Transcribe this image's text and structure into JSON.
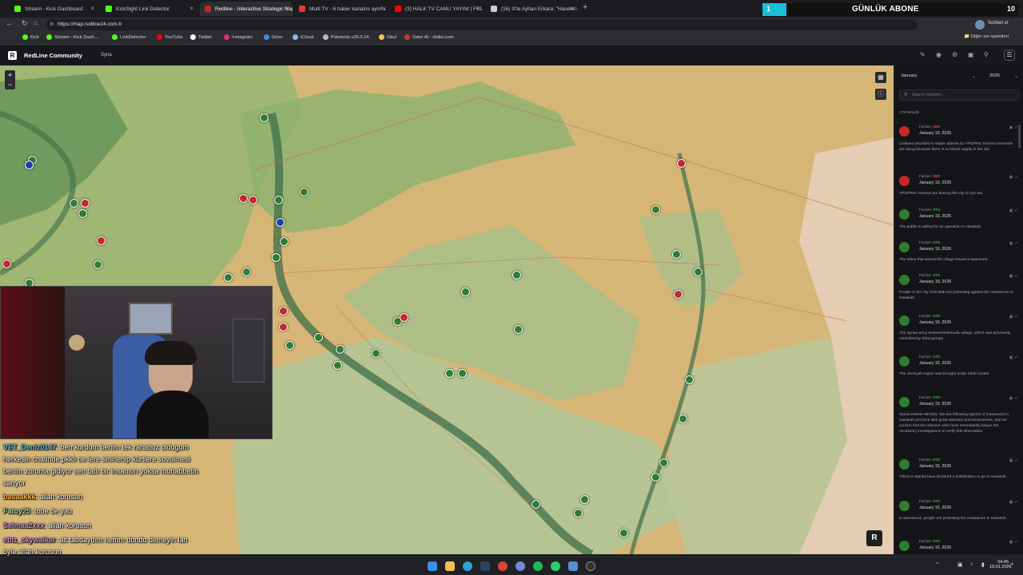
{
  "browser": {
    "tabs": [
      {
        "label": "Stream - Kick Dashboard",
        "active": false,
        "color": "#53fc18"
      },
      {
        "label": "KickSight Link Detector",
        "active": false,
        "color": "#53fc18"
      },
      {
        "label": "Redline - Interactive Strategic Map",
        "active": true,
        "color": "#c62828"
      },
      {
        "label": "Multi TV - 6 haber kanalını aynı a",
        "active": false,
        "color": "#e53935"
      },
      {
        "label": "(3) HALK TV CANLI YAYINI | FULL H",
        "active": false,
        "color": "#ff0000"
      },
      {
        "label": "(16) X'te Ayhan Erkara: \"Haseke'd",
        "active": false,
        "color": "#cccccc"
      }
    ],
    "url": "https://map.redline24.com.tr",
    "bookmarks": [
      "Kick",
      "Stream - Kick Dash...",
      "LinkDetector",
      "YouTube",
      "Twitter",
      "Instagram",
      "Drive",
      "iCloud",
      "Paletools v26.0.24",
      "Okul",
      "Satın Al - obilet.com"
    ],
    "other_bookmarks": "Diğer yer işaretleri",
    "sohbet": "Sohbet et"
  },
  "overlay": {
    "sub_goal_label": "GÜNLÜK ABONE",
    "sub_goal_current": "1",
    "sub_goal_target": "10"
  },
  "app": {
    "brand": "RedLine Community",
    "breadcrumb": "Syria",
    "month_select": "January",
    "year_select": "2026",
    "search_placeholder": "Search Markers...",
    "results_count": "178 Results",
    "faction_label": "Faction:"
  },
  "feed": [
    {
      "faction": "SDF",
      "date": "January 19, 2026",
      "text": "Civilians wounded in sniper attacks by YPG/PKK terrorist remnants are dying because there is no blood supply in the city.",
      "color": "#c62828"
    },
    {
      "faction": "SDF",
      "date": "January 19, 2026",
      "text": "YPG/PKK convoys are leaving the city of Ayn-Isa.",
      "color": "#c62828"
    },
    {
      "faction": "STG",
      "date": "January 19, 2026",
      "text": "The public is calling for an operation in Hasakah.",
      "color": "#2e7d32"
    },
    {
      "faction": "STG",
      "date": "January 19, 2026",
      "text": "The tribes that seized the village issued a statement.",
      "color": "#2e7d32"
    },
    {
      "faction": "STG",
      "date": "January 19, 2026",
      "text": "People in the city of El-Bab are protesting against the massacres in Hasakah.",
      "color": "#2e7d32"
    },
    {
      "faction": "STG",
      "date": "January 19, 2026",
      "text": "The Syrian army entered Mahmudlu village, which was previously controlled by tribal groups.",
      "color": "#2e7d32"
    },
    {
      "faction": "STG",
      "date": "January 19, 2026",
      "text": "The Jarmiyah region was brought under tribal control.",
      "color": "#2e7d32"
    },
    {
      "faction": "STG",
      "date": "January 19, 2026",
      "text": "Syrian Interior Ministry: We are following reports of massacres in Hasakah province with great attention and seriousness, and we confirm that the relevant units have immediately begun the necessary investigations to verify this information.",
      "color": "#2e7d32"
    },
    {
      "faction": "STG",
      "date": "January 19, 2026",
      "text": "Tribes in Manbij have declared a mobilization to go to Hasakah.",
      "color": "#2e7d32"
    },
    {
      "faction": "STG",
      "date": "January 19, 2026",
      "text": "In Damascus, people are protesting the massacres in Hasakah.",
      "color": "#2e7d32"
    },
    {
      "faction": "STG",
      "date": "January 19, 2026",
      "text": "",
      "color": "#2e7d32"
    }
  ],
  "chat": [
    {
      "user": "VET_Deniz0147",
      "msg": ": ben kurdum benim tek rahatsız oldugum",
      "color": "#4fc3f7"
    },
    {
      "user": "",
      "msg": "herkesin chatinde pkkli oe lere sinirlenip kürtlere sovulmesi",
      "color": "#ffffff"
    },
    {
      "user": "",
      "msg": "benim zoruma gidiyor sen tatlı bir insansın yoksa muhabbetin",
      "color": "#ffffff"
    },
    {
      "user": "",
      "msg": "sarıyor",
      "color": "#ffffff"
    },
    {
      "user": "basaakkk",
      "msg": ": allah korusun",
      "color": "#ffb74d"
    },
    {
      "user": "Fatoy25",
      "msg": ": tobe de yau",
      "color": "#a5d6a7"
    },
    {
      "user": "Selmaa2xxx",
      "msg": ": allah korusun",
      "color": "#ce93d8"
    },
    {
      "user": "ebiz_skywalker",
      "msg": ": alt tabdaydım nefrim dondu demeyin lan",
      "color": "#ce93d8"
    },
    {
      "user": "",
      "msg": "öyle allah korusun",
      "color": "#ffffff"
    },
    {
      "user": "aysplan",
      "msg": ": allah korusun",
      "color": "#ffffff"
    }
  ],
  "taskbar": {
    "time": "04:45",
    "date": "19.01.2026"
  },
  "map": {
    "zoom_in": "+",
    "zoom_out": "−"
  }
}
